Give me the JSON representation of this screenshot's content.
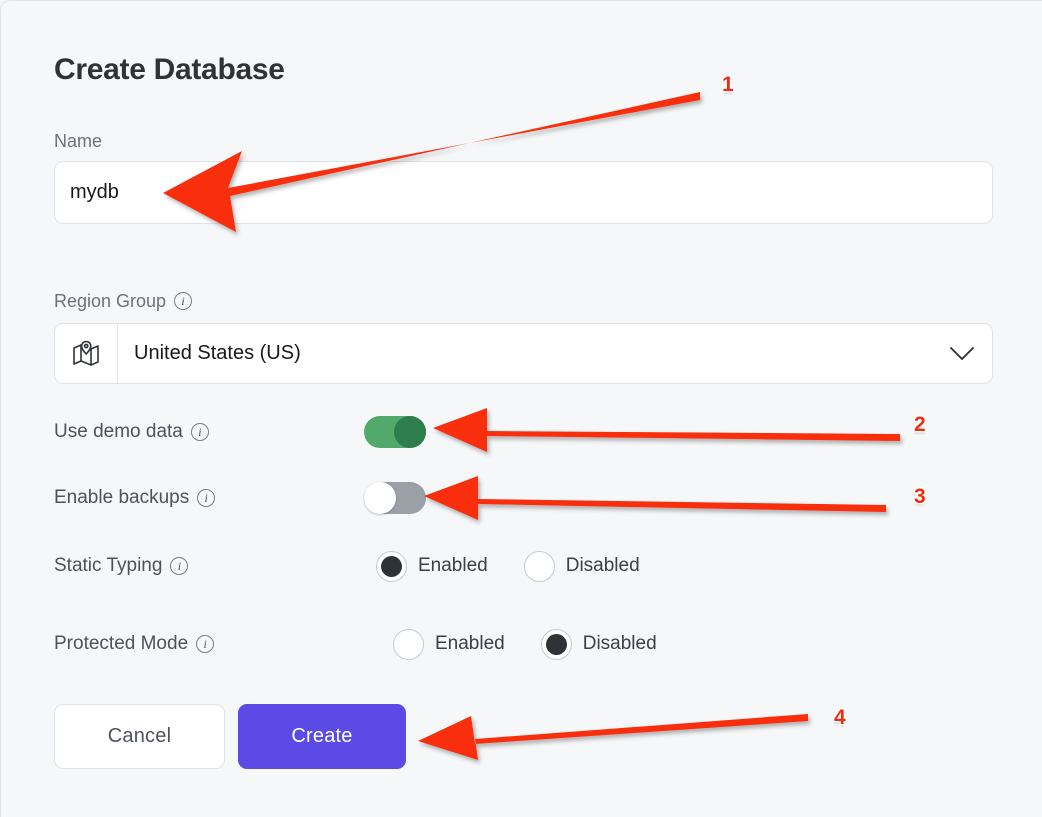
{
  "dialog": {
    "title": "Create Database"
  },
  "name_field": {
    "label": "Name",
    "value": "mydb",
    "placeholder": "Name"
  },
  "region_group": {
    "label": "Region Group",
    "info": "i",
    "value": "United States (US)",
    "icon": "map-pin-icon",
    "chevron": "chevron-down-icon"
  },
  "options": {
    "demo_data": {
      "label": "Use demo data",
      "info": "i",
      "state": "on"
    },
    "backups": {
      "label": "Enable backups",
      "info": "i",
      "state": "off"
    },
    "static_typing": {
      "label": "Static Typing",
      "info": "i",
      "enabled_label": "Enabled",
      "disabled_label": "Disabled",
      "selected": "Enabled"
    },
    "protected_mode": {
      "label": "Protected Mode",
      "info": "i",
      "enabled_label": "Enabled",
      "disabled_label": "Disabled",
      "selected": "Disabled"
    }
  },
  "buttons": {
    "cancel_label": "Cancel",
    "create_label": "Create"
  },
  "annotations": {
    "markers": [
      {
        "number": "1",
        "target": "name-input"
      },
      {
        "number": "2",
        "target": "use-demo-data-toggle"
      },
      {
        "number": "3",
        "target": "enable-backups-toggle"
      },
      {
        "number": "4",
        "target": "create-button"
      }
    ],
    "color": "#f22b10"
  },
  "colors": {
    "background": "#f6f7f9",
    "surface": "#ffffff",
    "border": "#dfe3e8",
    "primary": "#5b4ae6",
    "toggle_on_track": "#51a96b",
    "toggle_on_knob": "#2e7d4f",
    "toggle_off_track": "#9aa0a6",
    "text": "#2e3338",
    "muted_text": "#6b7177",
    "annotation": "#f22b10"
  }
}
